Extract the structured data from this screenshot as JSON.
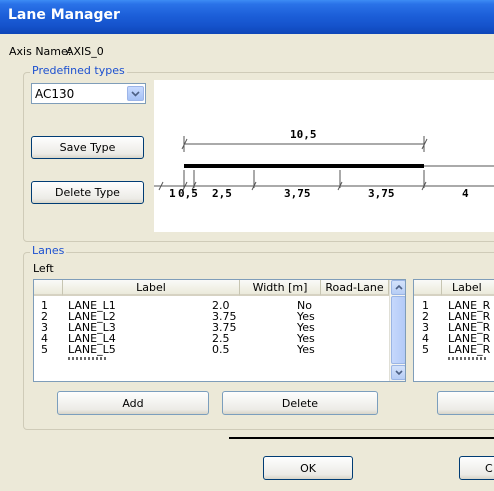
{
  "window": {
    "title": "Lane Manager"
  },
  "axis": {
    "label": "Axis Name:",
    "value": "AXIS_0"
  },
  "predefined": {
    "group_label": "Predefined types",
    "selected_type": "AC130",
    "save_type_label": "Save Type",
    "delete_type_label": "Delete Type"
  },
  "preview": {
    "total_width": "10,5",
    "segments": [
      "1",
      "0,5",
      "2,5",
      "3,75",
      "3,75",
      "4"
    ]
  },
  "lanes": {
    "group_label": "Lanes",
    "left_label": "Left",
    "left_grid": {
      "headers": [
        "Label",
        "Width [m]",
        "Road-Lane"
      ],
      "rows": [
        {
          "index": "1",
          "label": "LANE_L1",
          "width": "2.0",
          "road_lane": "No"
        },
        {
          "index": "2",
          "label": "LANE_L2",
          "width": "3.75",
          "road_lane": "Yes"
        },
        {
          "index": "3",
          "label": "LANE_L3",
          "width": "3.75",
          "road_lane": "Yes"
        },
        {
          "index": "4",
          "label": "LANE_L4",
          "width": "2.5",
          "road_lane": "Yes"
        },
        {
          "index": "5",
          "label": "LANE_L5",
          "width": "0.5",
          "road_lane": "Yes"
        }
      ]
    },
    "right_grid": {
      "headers": [
        "Label"
      ],
      "rows": [
        {
          "index": "1",
          "label": "LANE_R"
        },
        {
          "index": "2",
          "label": "LANE_R"
        },
        {
          "index": "3",
          "label": "LANE_R"
        },
        {
          "index": "4",
          "label": "LANE_R"
        },
        {
          "index": "5",
          "label": "LANE_R"
        }
      ]
    },
    "add_label": "Add",
    "delete_label": "Delete"
  },
  "footer": {
    "ok_label": "OK",
    "cancel_label": "C"
  }
}
